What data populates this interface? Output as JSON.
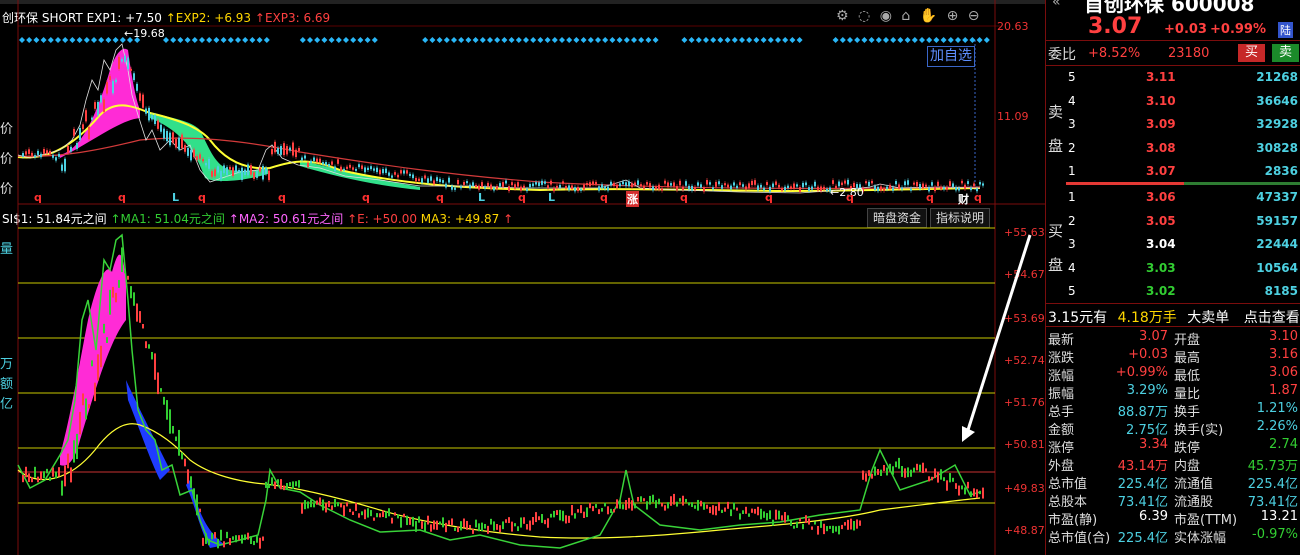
{
  "upper_legend": {
    "name": "创环保",
    "short_label": "SHORT",
    "exp1": "EXP1: +7.50",
    "exp2": "↑EXP2: +6.93",
    "exp3": "↑EXP3: 6.69"
  },
  "upper_axis": {
    "top": "20.63",
    "mid": "11.09"
  },
  "peak_label": "19.68",
  "low_label": "2.80",
  "add_watch": "加自选",
  "markers": {
    "q": "q",
    "L": "L",
    "zhang": "涨",
    "cai": "财"
  },
  "lower_legend": {
    "si": "SI$1: 51.84元之间",
    "ma1": "↑MA1: 51.04元之间",
    "ma2": "↑MA2: 50.61元之间",
    "e": "↑E: +50.00",
    "ma3": "MA3: +49.87",
    "arrow": "↑"
  },
  "lower_buttons": {
    "dark": "暗盘资金",
    "explain": "指标说明"
  },
  "lower_axis": [
    "+55.63",
    "+54.67",
    "+53.69",
    "+52.74",
    "+51.76",
    "+50.81",
    "+49.83",
    "+48.87"
  ],
  "left_edge_labels": [
    "价",
    "价",
    "价",
    "量",
    "万",
    "额",
    "亿"
  ],
  "header": {
    "name_partial": "首创环保 600008",
    "price": "3.07",
    "change": "+0.03",
    "change_pct": "+0.99%",
    "exchange_badge": "陆"
  },
  "order_book_header": {
    "label": "委比",
    "ratio": "+8.52%",
    "diff": "23180",
    "buy_btn": "买",
    "sell_btn": "卖"
  },
  "sell_side_label": [
    "卖",
    "盘"
  ],
  "buy_side_label": [
    "买",
    "盘"
  ],
  "asks": [
    {
      "level": "5",
      "price": "3.11",
      "vol": "21268"
    },
    {
      "level": "4",
      "price": "3.10",
      "vol": "36646"
    },
    {
      "level": "3",
      "price": "3.09",
      "vol": "32928"
    },
    {
      "level": "2",
      "price": "3.08",
      "vol": "30828"
    },
    {
      "level": "1",
      "price": "3.07",
      "vol": "2836"
    }
  ],
  "bids": [
    {
      "level": "1",
      "price": "3.06",
      "vol": "47337"
    },
    {
      "level": "2",
      "price": "3.05",
      "vol": "59157"
    },
    {
      "level": "3",
      "price": "3.04",
      "vol": "22444"
    },
    {
      "level": "4",
      "price": "3.03",
      "vol": "10564"
    },
    {
      "level": "5",
      "price": "3.02",
      "vol": "8185"
    }
  ],
  "big_order": {
    "price": "3.15元有",
    "vol": "4.18万手",
    "label": "大卖单",
    "action": "点击查看"
  },
  "stats": [
    {
      "l1": "最新",
      "v1": "3.07",
      "c1": "red",
      "l2": "开盘",
      "v2": "3.10",
      "c2": "red"
    },
    {
      "l1": "涨跌",
      "v1": "+0.03",
      "c1": "red",
      "l2": "最高",
      "v2": "3.16",
      "c2": "red"
    },
    {
      "l1": "涨幅",
      "v1": "+0.99%",
      "c1": "red",
      "l2": "最低",
      "v2": "3.06",
      "c2": "red"
    },
    {
      "l1": "振幅",
      "v1": "3.29%",
      "c1": "cyan",
      "l2": "量比",
      "v2": "1.87",
      "c2": "red"
    },
    {
      "l1": "总手",
      "v1": "88.87万",
      "c1": "cyan",
      "l2": "换手",
      "v2": "1.21%",
      "c2": "cyan"
    },
    {
      "l1": "金额",
      "v1": "2.75亿",
      "c1": "cyan",
      "l2": "换手(实)",
      "v2": "2.26%",
      "c2": "cyan"
    },
    {
      "l1": "涨停",
      "v1": "3.34",
      "c1": "red",
      "l2": "跌停",
      "v2": "2.74",
      "c2": "green"
    },
    {
      "l1": "外盘",
      "v1": "43.14万",
      "c1": "red",
      "l2": "内盘",
      "v2": "45.73万",
      "c2": "green"
    },
    {
      "l1": "总市值",
      "v1": "225.4亿",
      "c1": "cyan",
      "l2": "流通值",
      "v2": "225.4亿",
      "c2": "cyan"
    },
    {
      "l1": "总股本",
      "v1": "73.41亿",
      "c1": "cyan",
      "l2": "流通股",
      "v2": "73.41亿",
      "c2": "cyan"
    },
    {
      "l1": "市盈(静)",
      "v1": "6.39",
      "c1": "white",
      "l2": "市盈(TTM)",
      "v2": "13.21",
      "c2": "white"
    },
    {
      "l1": "总市值(合)",
      "v1": "225.4亿",
      "c1": "cyan",
      "l2": "实体涨幅",
      "v2": "-0.97%",
      "c2": "green"
    }
  ],
  "colors": {
    "up": "#ff4040",
    "down": "#32cd32",
    "accent": "#4dd0e1",
    "bg": "#000000"
  }
}
